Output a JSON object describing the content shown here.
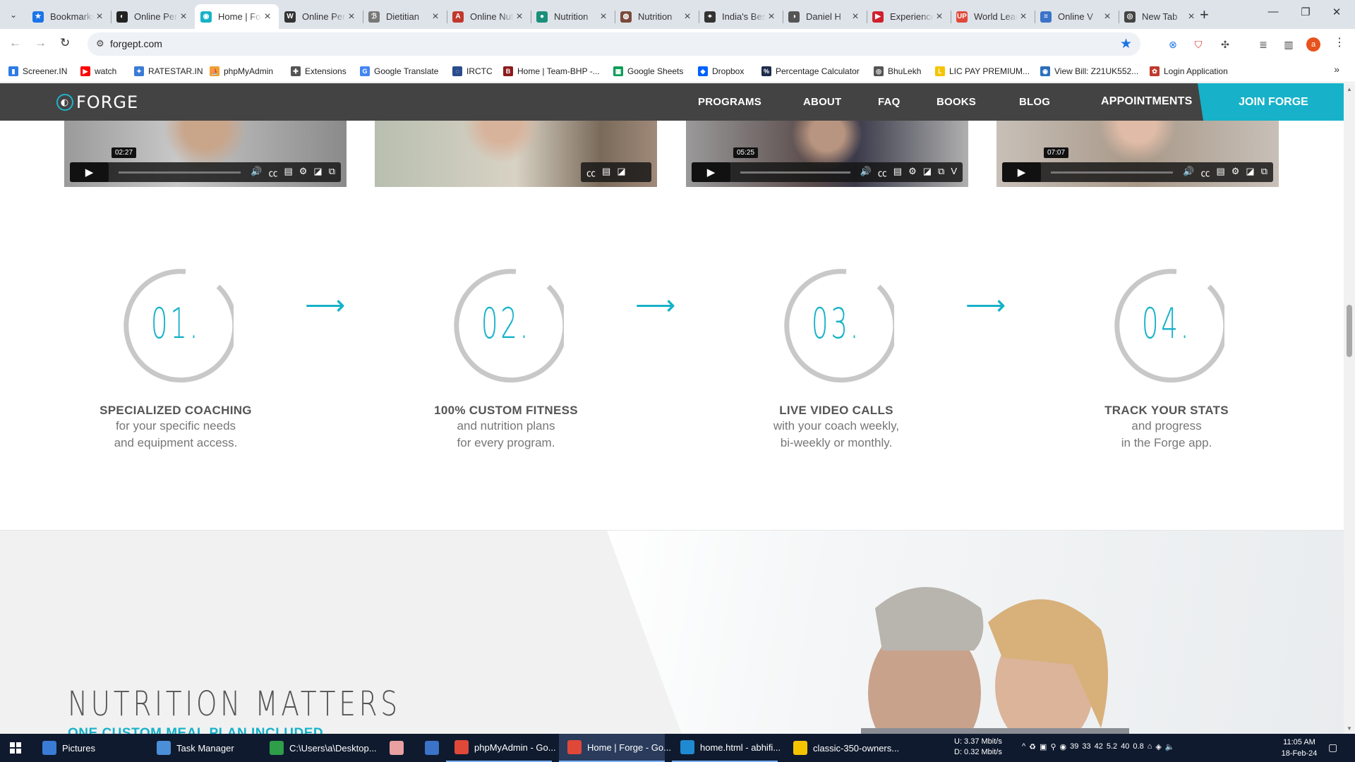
{
  "browser": {
    "tabs": [
      {
        "title": "Bookmarks",
        "fav_color": "#1a73e8",
        "fav_glyph": "★",
        "active": false
      },
      {
        "title": "Online Personal",
        "fav_color": "#222222",
        "fav_glyph": "◐",
        "active": false
      },
      {
        "title": "Home | Forge",
        "fav_color": "#17b2c9",
        "fav_glyph": "◉",
        "active": true
      },
      {
        "title": "Online Personal",
        "fav_color": "#333333",
        "fav_glyph": "W",
        "active": false
      },
      {
        "title": "Dietitian",
        "fav_color": "#777777",
        "fav_glyph": "ℬ",
        "active": false
      },
      {
        "title": "Online Nutrition",
        "fav_color": "#c0392b",
        "fav_glyph": "A",
        "active": false
      },
      {
        "title": "Nutrition",
        "fav_color": "#1a8f7a",
        "fav_glyph": "●",
        "active": false
      },
      {
        "title": "Nutrition",
        "fav_color": "#7a4a3a",
        "fav_glyph": "◍",
        "active": false
      },
      {
        "title": "India's Best",
        "fav_color": "#333333",
        "fav_glyph": "⌖",
        "active": false
      },
      {
        "title": "Daniel H",
        "fav_color": "#555555",
        "fav_glyph": "◑",
        "active": false
      },
      {
        "title": "Experience",
        "fav_color": "#d0202e",
        "fav_glyph": "▶",
        "active": false
      },
      {
        "title": "World Leaders",
        "fav_color": "#e04a3a",
        "fav_glyph": "UP",
        "active": false
      },
      {
        "title": "Online V",
        "fav_color": "#3b73c8",
        "fav_glyph": "≡",
        "active": false
      },
      {
        "title": "New Tab",
        "fav_color": "#444444",
        "fav_glyph": "◎",
        "active": false
      }
    ],
    "url": "forgept.com",
    "profile_initial": "a",
    "bookmarks": [
      {
        "label": "Screener.IN",
        "color": "#2c7be5",
        "glyph": "▮"
      },
      {
        "label": "watch",
        "color": "#ff0000",
        "glyph": "▶"
      },
      {
        "label": "RATESTAR.IN",
        "color": "#3a7bd5",
        "glyph": "✦"
      },
      {
        "label": "phpMyAdmin",
        "color": "#f0a030",
        "glyph": "⛵"
      },
      {
        "label": "Extensions",
        "color": "#555555",
        "glyph": "✚"
      },
      {
        "label": "Google Translate",
        "color": "#4285f4",
        "glyph": "G"
      },
      {
        "label": "IRCTC",
        "color": "#2b4c8c",
        "glyph": "◌"
      },
      {
        "label": "Home | Team-BHP -...",
        "color": "#8b1a1a",
        "glyph": "B"
      },
      {
        "label": "Google Sheets",
        "color": "#0f9d58",
        "glyph": "▦"
      },
      {
        "label": "Dropbox",
        "color": "#0061fe",
        "glyph": "◆"
      },
      {
        "label": "Percentage Calculator",
        "color": "#1c2b4a",
        "glyph": "%"
      },
      {
        "label": "BhuLekh",
        "color": "#555555",
        "glyph": "◎"
      },
      {
        "label": "LIC PAY PREMIUM...",
        "color": "#f5c400",
        "glyph": "L"
      },
      {
        "label": "View Bill: Z21UK552...",
        "color": "#2a6ebb",
        "glyph": "◉"
      },
      {
        "label": "Login Application",
        "color": "#c0392b",
        "glyph": "✿"
      }
    ]
  },
  "site": {
    "brand": "FORGE",
    "accent": "#17b2c9",
    "nav": {
      "programs": "PROGRAMS",
      "about": "ABOUT",
      "faq": "FAQ",
      "books": "BOOKS",
      "blog": "BLOG",
      "appointments": "APPOINTMENTS",
      "join": "JOIN FORGE"
    },
    "videos": [
      {
        "time": "02:27",
        "has_play": true
      },
      {
        "time": "",
        "has_play": false
      },
      {
        "time": "05:25",
        "has_play": true
      },
      {
        "time": "07:07",
        "has_play": true
      }
    ],
    "steps": [
      {
        "number": "01.",
        "title": "SPECIALIZED COACHING",
        "line1": "for your specific needs",
        "line2": "and equipment access."
      },
      {
        "number": "02.",
        "title": "100% CUSTOM FITNESS",
        "line1": "and nutrition plans",
        "line2": "for every program."
      },
      {
        "number": "03.",
        "title": "LIVE VIDEO CALLS",
        "line1": "with your coach weekly,",
        "line2": "bi-weekly or monthly."
      },
      {
        "number": "04.",
        "title": "TRACK YOUR STATS",
        "line1": "and progress",
        "line2": "in the Forge app."
      }
    ],
    "nutrition": {
      "title": "NUTRITION MATTERS",
      "subtitle": "ONE CUSTOM MEAL PLAN INCLUDED"
    }
  },
  "taskbar": {
    "items": [
      {
        "label": "Pictures",
        "color": "#3a7bd5"
      },
      {
        "label": "Task Manager",
        "color": "#4a8fd8"
      },
      {
        "label": "C:\\Users\\a\\Desktop...",
        "color": "#2e9e49"
      },
      {
        "label": "",
        "color": "#e8a0a0"
      },
      {
        "label": "",
        "color": "#3b73c8"
      },
      {
        "label": "phpMyAdmin - Go...",
        "color": "#e0483a"
      },
      {
        "label": "Home | Forge - Go...",
        "color": "#e0483a"
      },
      {
        "label": "home.html - abhifi...",
        "color": "#1f8ad2"
      },
      {
        "label": "classic-350-owners...",
        "color": "#f5c400"
      }
    ],
    "net_up": "U:   3.37 Mbit/s",
    "net_down": "D:   0.32 Mbit/s",
    "tray_values": [
      "39",
      "33",
      "42",
      "5.2",
      "40",
      "0.8"
    ],
    "time": "11:05 AM",
    "date": "18-Feb-24"
  }
}
